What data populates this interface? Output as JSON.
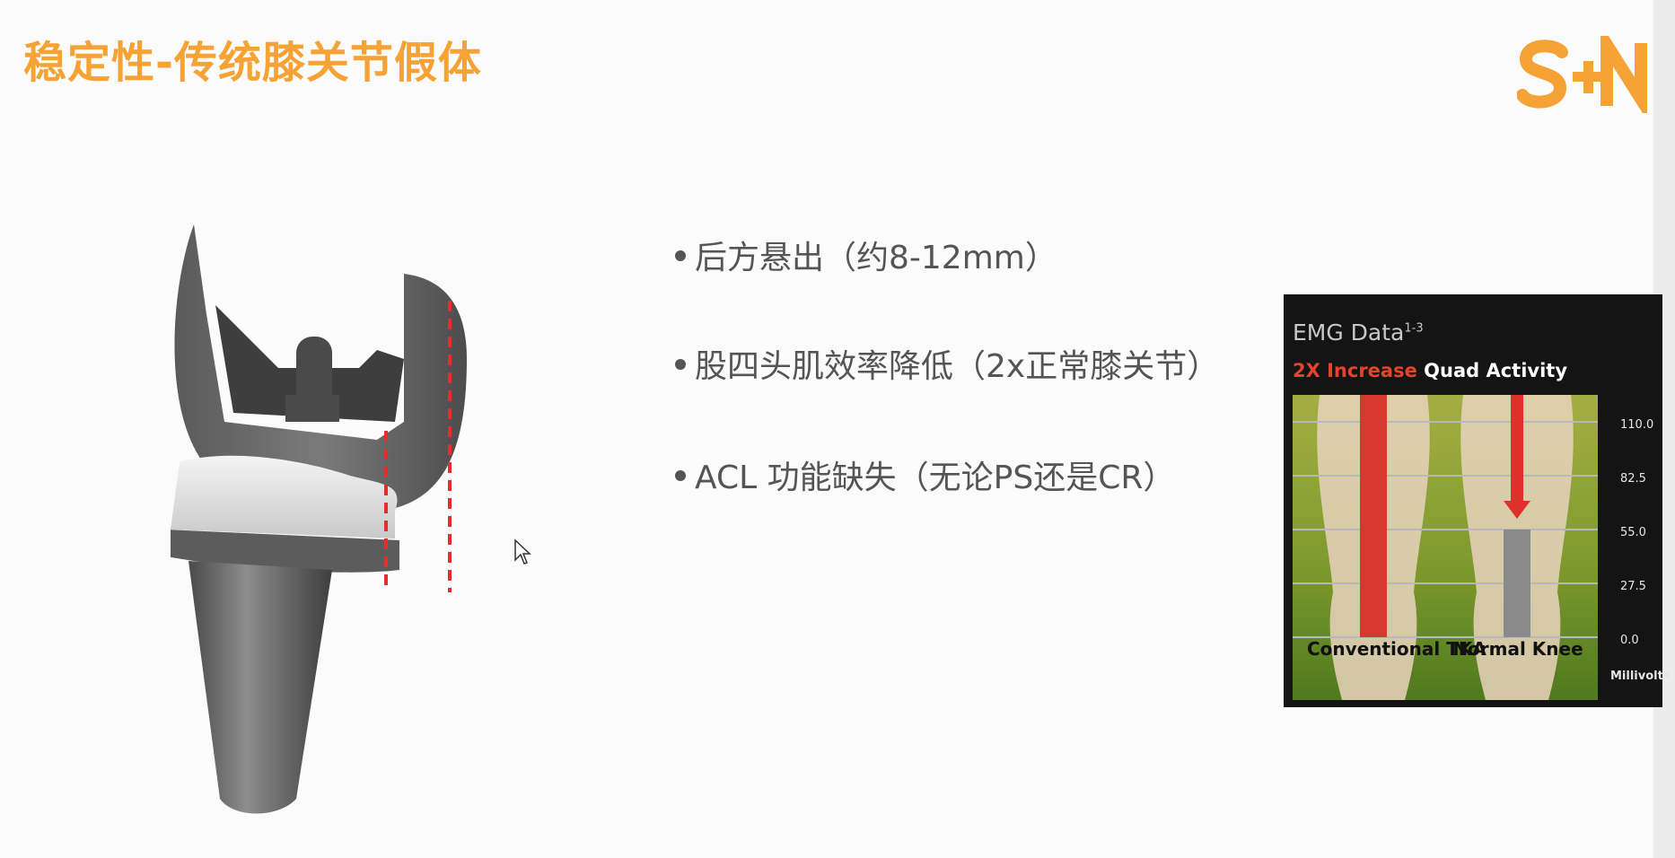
{
  "slide": {
    "title": "稳定性-传统膝关节假体",
    "logo_text": "S+N",
    "accent_color": "#f6a234"
  },
  "bullets": [
    {
      "text": "后方悬出（约8-12mm）"
    },
    {
      "text": "股四头肌效率降低（2x正常膝关节）"
    },
    {
      "text": "ACL 功能缺失（无论PS还是CR）"
    }
  ],
  "knee_image": {
    "icon": "knee-implant-illustration",
    "marker_color": "#e0302a"
  },
  "emg_chart": {
    "title": "EMG Data",
    "title_superscript": "1-3",
    "subtitle_highlight": "2X Increase",
    "subtitle_rest": "Quad Activity",
    "yticks": [
      "110.0",
      "82.5",
      "55.0",
      "27.5",
      "0.0"
    ],
    "yunit": "Millivolts"
  },
  "chart_data": {
    "type": "bar",
    "title": "EMG Data",
    "subtitle": "2X Increase Quad Activity",
    "categories": [
      "Conventional TKA",
      "Normal Knee"
    ],
    "values": [
      110.0,
      55.0
    ],
    "ylabel": "Millivolts",
    "ylim": [
      0,
      110
    ],
    "yticks": [
      0.0,
      27.5,
      55.0,
      82.5,
      110.0
    ],
    "grid": true,
    "colors": {
      "Conventional TKA": "#d63a2f",
      "Normal Knee": "#8a8a8a"
    }
  }
}
